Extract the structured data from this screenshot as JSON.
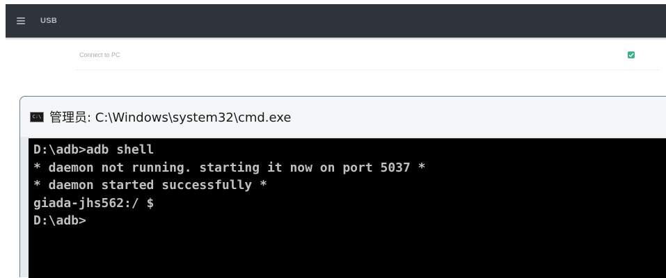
{
  "settings": {
    "appbar_title": "USB",
    "menu_icon": "hamburger-menu-icon",
    "items": [
      {
        "label": "Connect to PC",
        "checked": true,
        "check_color": "#3fae8e"
      }
    ],
    "appbar_color": "#2f343b"
  },
  "cmd": {
    "title": "管理员: C:\\Windows\\system32\\cmd.exe",
    "app_icon_text": "C:\\",
    "lines": [
      "D:\\adb>adb shell",
      "* daemon not running. starting it now on port 5037 *",
      "* daemon started successfully *",
      "giada-jhs562:/ $",
      "D:\\adb>"
    ],
    "console_bg": "#000000",
    "console_fg": "#c0c0c0"
  }
}
